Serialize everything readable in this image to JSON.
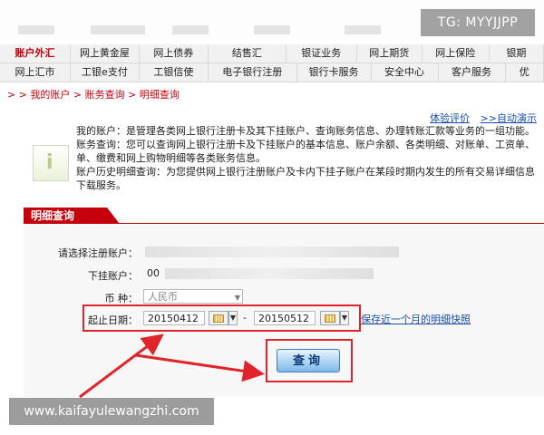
{
  "badge": {
    "tg": "TG: MYYJJPP"
  },
  "nav": {
    "row1": [
      "账户外汇",
      "网上黄金屋",
      "网上债券",
      "结售汇",
      "银证业务",
      "网上期货",
      "网上保险",
      "银期"
    ],
    "row2": [
      "网上汇市",
      "工银e支付",
      "工银信使",
      "电子银行注册",
      "银行卡服务",
      "安全中心",
      "客户服务",
      "优"
    ],
    "active": "账户外汇"
  },
  "breadcrumb": {
    "prefix": "> > ",
    "items": [
      "我的账户",
      "账务查询",
      "明细查询"
    ],
    "sep": " > "
  },
  "toplinks": {
    "feedback": "体验评价",
    "autoplay": ">>自动演示"
  },
  "description": [
    "我的账户：是管理各类网上银行注册卡及其下挂账户、查询账务信息、办理转账汇款等业务的一组功能。",
    "账务查询：您可以查询网上银行注册卡及下挂账户的基本信息、账户余额、各类明细、对账单、工资单、",
    "单、缴费和网上购物明细等各类账务信息。",
    "账户历史明细查询：为您提供网上银行注册账户及卡内下挂子账户在某段时期内发生的所有交易详细信息",
    "下载服务。"
  ],
  "panel": {
    "title": "明细查询",
    "account_label": "请选择注册账户：",
    "sub_account_label": "下挂账户：",
    "sub_account_prefix": "00",
    "currency_label": "币    种：",
    "currency_value": "人民币",
    "date_label": "起止日期：",
    "start_date": "20150412",
    "end_date": "20150512",
    "date_sep": "-",
    "save_link": "保存近一个月的明细快照",
    "query_button": "查询"
  },
  "watermark": "www.kaifayulewangzhi.com",
  "colors": {
    "accent_red": "#c4000b",
    "highlight_red": "#e0242b",
    "link_blue": "#1a4fa8"
  }
}
